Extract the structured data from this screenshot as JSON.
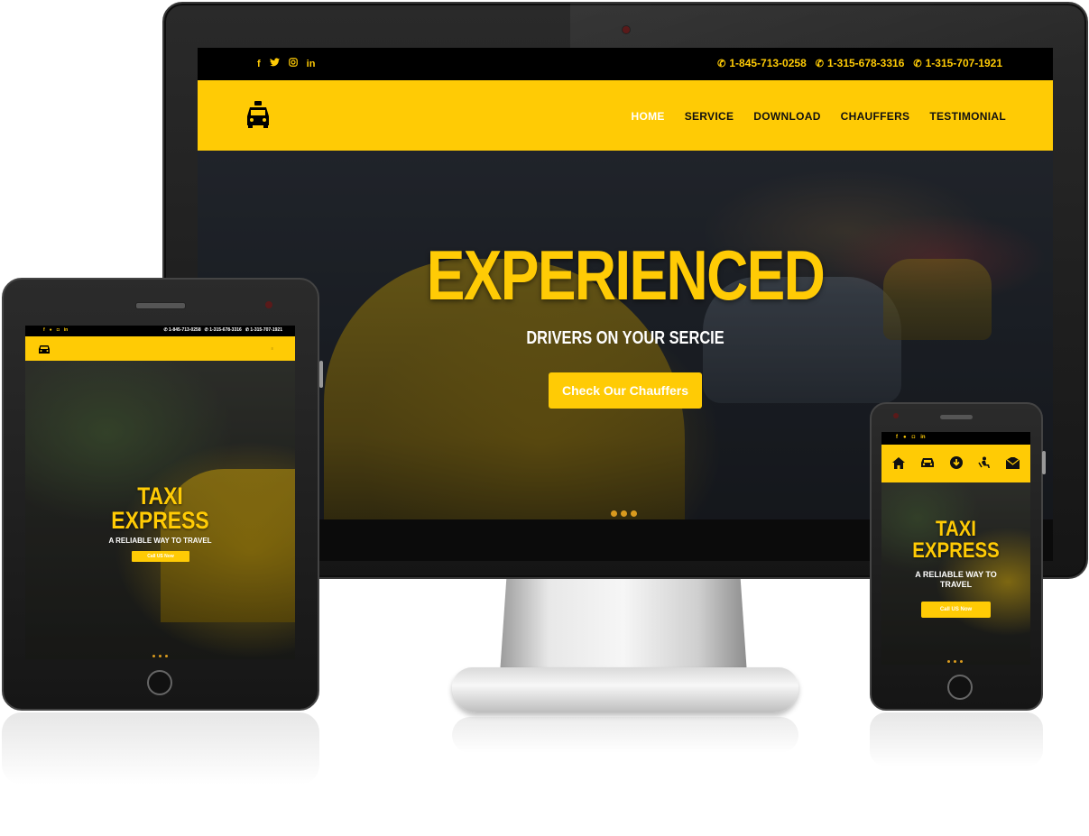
{
  "colors": {
    "accent": "#ffcb05",
    "dark": "#000000",
    "text_light": "#ffffff"
  },
  "desktop": {
    "social_icons": [
      "facebook-icon",
      "twitter-icon",
      "instagram-icon",
      "linkedin-icon"
    ],
    "phones": [
      "1-845-713-0258",
      "1-315-678-3316",
      "1-315-707-1921"
    ],
    "nav": {
      "logo_icon": "taxi-icon",
      "items": [
        "HOME",
        "SERVICE",
        "DOWNLOAD",
        "CHAUFFERS",
        "TESTIMONIAL"
      ],
      "active": "HOME"
    },
    "hero": {
      "title": "EXPERIENCED",
      "subtitle": "DRIVERS ON YOUR SERCIE",
      "button_label": "Check Our Chauffers"
    },
    "slider_dots": 3
  },
  "tablet": {
    "phones": [
      "1-845-713-0258",
      "1-315-678-3316",
      "1-315-707-1921"
    ],
    "hero": {
      "title_line1": "TAXI",
      "title_line2": "EXPRESS",
      "subtitle": "A RELIABLE WAY TO TRAVEL",
      "button_label": "Call US Now"
    },
    "slider_dots": 3
  },
  "phone": {
    "nav_icons": [
      "home-icon",
      "car-icon",
      "download-icon",
      "chauffeur-icon",
      "mail-icon"
    ],
    "hero": {
      "title_line1": "TAXI",
      "title_line2": "EXPRESS",
      "subtitle": "A RELIABLE WAY TO TRAVEL",
      "button_label": "Call US Now"
    },
    "slider_dots": 3
  }
}
